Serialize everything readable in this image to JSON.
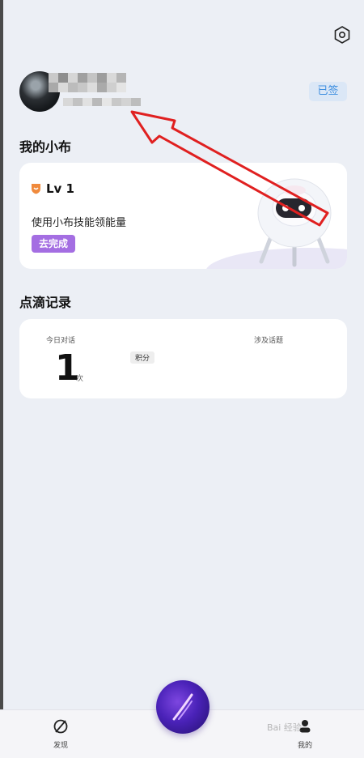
{
  "header": {
    "signed_label": "已签"
  },
  "xiaobu": {
    "section_title": "我的小布",
    "level": "Lv 1",
    "skill_text": "使用小布技能领能量",
    "action_label": "去完成"
  },
  "records": {
    "section_title": "点滴记录",
    "today_label": "今日对话",
    "today_value": "1",
    "today_unit": "次",
    "points_label": "积分",
    "topics_label": "涉及话题"
  },
  "nav": {
    "discover_label": "发现",
    "mine_label": "我的"
  },
  "watermark": "Bai 经验",
  "colors": {
    "accent_purple": "#a46ee2",
    "signed_blue": "#3f8fe0",
    "annotation_red": "#e02020"
  },
  "icons": [
    "settings-icon",
    "level-badge-icon",
    "discover-icon",
    "mine-icon",
    "assistant-orb-icon"
  ]
}
